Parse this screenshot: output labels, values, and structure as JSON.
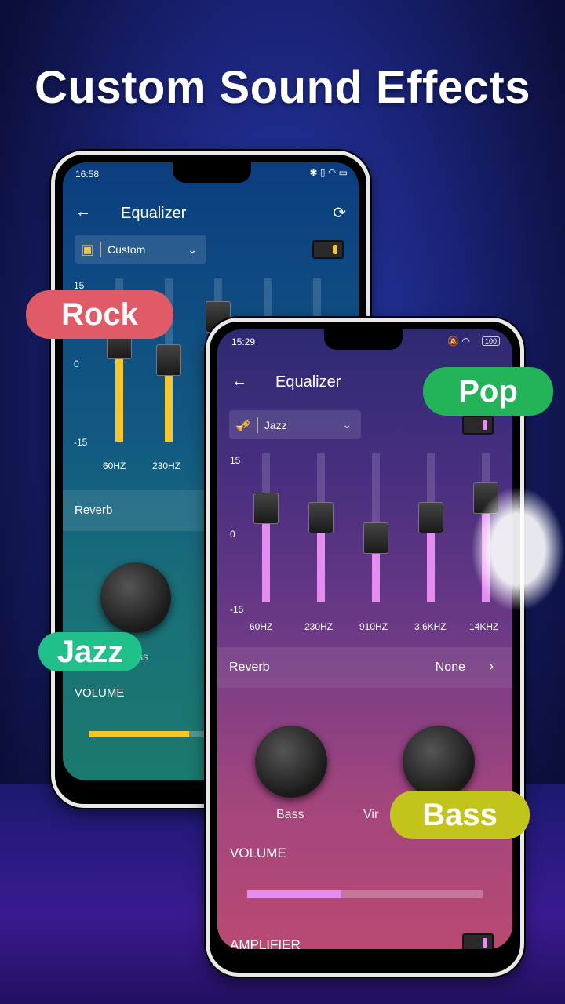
{
  "headline": "Custom Sound Effects",
  "back_phone": {
    "status_time": "16:58",
    "title": "Equalizer",
    "preset": "Custom",
    "accent": "#f7c62b",
    "scale": {
      "max": "15",
      "mid": "0",
      "min": "-15"
    },
    "bands": [
      {
        "label": "60HZ",
        "value": 3
      },
      {
        "label": "230HZ",
        "value": 0
      },
      {
        "label": "",
        "value": 8
      },
      {
        "label": "",
        "value": 0
      },
      {
        "label": "",
        "value": 0
      }
    ],
    "reverb_label": "Reverb",
    "knob_label": "Bass",
    "volume_label": "VOLUME",
    "volume_level": 0.8
  },
  "front_phone": {
    "status_time": "15:29",
    "battery": "100",
    "title": "Equalizer",
    "preset": "Jazz",
    "accent": "#e58cf0",
    "scale": {
      "max": "15",
      "mid": "0",
      "min": "-15"
    },
    "bands": [
      {
        "label": "60HZ",
        "value": 4
      },
      {
        "label": "230HZ",
        "value": 2
      },
      {
        "label": "910HZ",
        "value": -2
      },
      {
        "label": "3.6KHZ",
        "value": 2
      },
      {
        "label": "14KHZ",
        "value": 6
      }
    ],
    "reverb_label": "Reverb",
    "reverb_value": "None",
    "knob1_label": "Bass",
    "knob2_label": "Vir",
    "volume_label": "VOLUME",
    "volume_level": 0.4,
    "amplifier_label": "AMPLIFIER"
  },
  "tags": {
    "rock": "Rock",
    "jazz": "Jazz",
    "pop": "Pop",
    "bass": "Bass"
  }
}
